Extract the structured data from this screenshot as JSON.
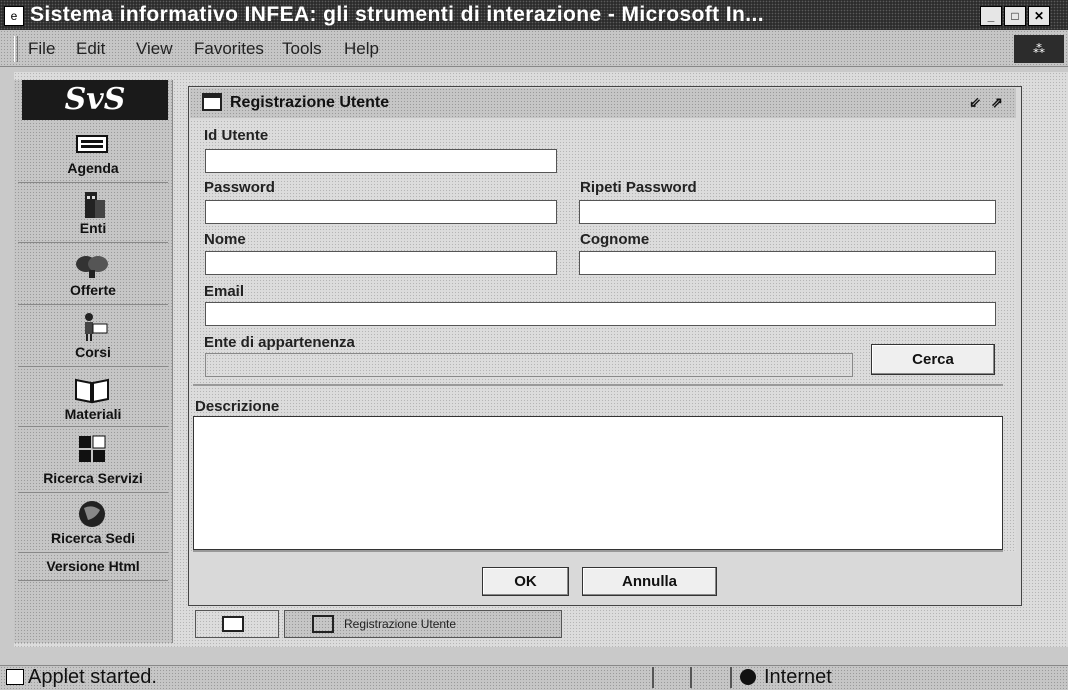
{
  "window": {
    "title": "Sistema informativo INFEA: gli strumenti di interazione - Microsoft In...",
    "icon": "ie-page-icon",
    "controls": [
      "minimize",
      "maximize",
      "close"
    ]
  },
  "menu": {
    "items": [
      "File",
      "Edit",
      "View",
      "Favorites",
      "Tools",
      "Help"
    ]
  },
  "sidebar": {
    "logo": "SvS",
    "items": [
      {
        "label": "Agenda",
        "icon": "keyboard-icon"
      },
      {
        "label": "Enti",
        "icon": "building-icon"
      },
      {
        "label": "Offerte",
        "icon": "handshake-icon"
      },
      {
        "label": "Corsi",
        "icon": "teacher-icon"
      },
      {
        "label": "Materiali",
        "icon": "book-icon"
      },
      {
        "label": "Ricerca Servizi",
        "icon": "services-grid-icon"
      },
      {
        "label": "Ricerca Sedi",
        "icon": "globe-icon"
      },
      {
        "label": "Versione Html",
        "icon": ""
      }
    ]
  },
  "form": {
    "title": "Registrazione Utente",
    "labels": {
      "id_utente": "Id Utente",
      "password": "Password",
      "ripeti_password": "Ripeti Password",
      "nome": "Nome",
      "cognome": "Cognome",
      "email": "Email",
      "ente": "Ente di appartenenza",
      "descrizione": "Descrizione"
    },
    "values": {
      "id_utente": "",
      "password": "",
      "ripeti_password": "",
      "nome": "",
      "cognome": "",
      "email": "",
      "ente": "",
      "descrizione": ""
    },
    "buttons": {
      "cerca": "Cerca",
      "ok": "OK",
      "annulla": "Annulla"
    }
  },
  "taskbar": {
    "frame_label": "Registrazione Utente"
  },
  "status": {
    "text": "Applet started.",
    "zone": "Internet"
  }
}
